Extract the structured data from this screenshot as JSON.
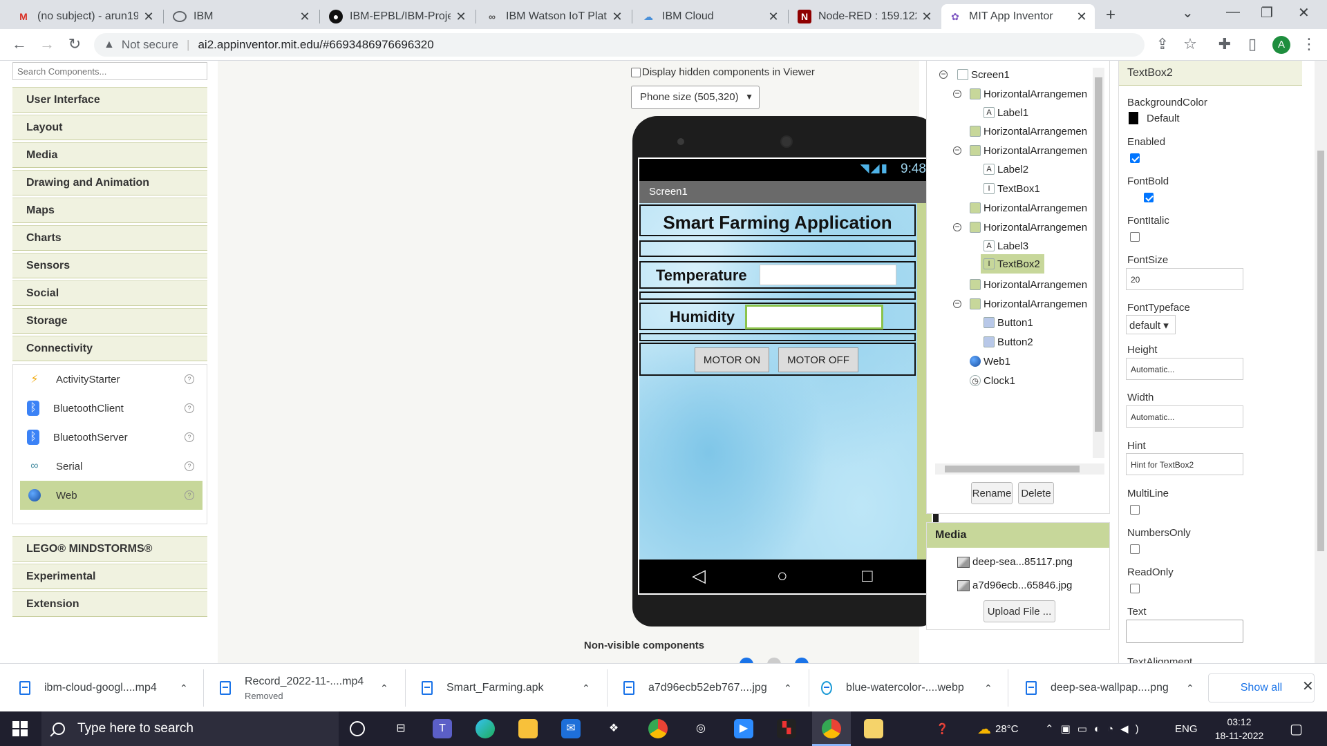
{
  "browser": {
    "tabs": [
      {
        "title": "(no subject) - arun191",
        "icon": "gmail-icon"
      },
      {
        "title": "IBM",
        "icon": "globe-icon"
      },
      {
        "title": "IBM-EPBL/IBM-Projec",
        "icon": "github-icon"
      },
      {
        "title": "IBM Watson IoT Platfo",
        "icon": "watson-icon"
      },
      {
        "title": "IBM Cloud",
        "icon": "cloud-icon"
      },
      {
        "title": "Node-RED : 159.122.1",
        "icon": "nodered-icon"
      },
      {
        "title": "MIT App Inventor",
        "icon": "appinventor-icon"
      }
    ],
    "new_tab": "+",
    "security": "Not secure",
    "url": "ai2.appinventor.mit.edu/#6693486976696320",
    "profile_initial": "A"
  },
  "palette": {
    "search_placeholder": "Search Components...",
    "categories_top": [
      "User Interface",
      "Layout",
      "Media",
      "Drawing and Animation",
      "Maps",
      "Charts",
      "Sensors",
      "Social",
      "Storage",
      "Connectivity"
    ],
    "components": [
      {
        "label": "ActivityStarter",
        "icon": "lightning-icon"
      },
      {
        "label": "BluetoothClient",
        "icon": "bluetooth-icon"
      },
      {
        "label": "BluetoothServer",
        "icon": "bluetooth-icon"
      },
      {
        "label": "Serial",
        "icon": "serial-icon"
      },
      {
        "label": "Web",
        "icon": "globe-icon"
      }
    ],
    "categories_bottom": [
      "LEGO® MINDSTORMS®",
      "Experimental",
      "Extension"
    ]
  },
  "viewer": {
    "hidden_label": "Display hidden components in Viewer",
    "phone_size": "Phone size (505,320)",
    "status_time": "9:48",
    "screen_title": "Screen1",
    "app_title": "Smart Farming Application",
    "temperature_label": "Temperature",
    "humidity_label": "Humidity",
    "motor_on": "MOTOR ON",
    "motor_off": "MOTOR OFF",
    "nonvisible_label": "Non-visible components"
  },
  "tree": {
    "nodes": [
      "Screen1",
      "HorizontalArrangemen",
      "Label1",
      "HorizontalArrangemen",
      "HorizontalArrangemen",
      "Label2",
      "TextBox1",
      "HorizontalArrangemen",
      "HorizontalArrangemen",
      "Label3",
      "TextBox2",
      "HorizontalArrangemen",
      "HorizontalArrangemen",
      "Button1",
      "Button2",
      "Web1",
      "Clock1"
    ],
    "selected": "TextBox2",
    "rename": "Rename",
    "delete": "Delete"
  },
  "media": {
    "title": "Media",
    "files": [
      "deep-sea...85117.png",
      "a7d96ecb...65846.jpg"
    ],
    "upload": "Upload File ..."
  },
  "properties": {
    "component": "TextBox2",
    "background_color_label": "BackgroundColor",
    "background_color_value": "Default",
    "enabled_label": "Enabled",
    "enabled": true,
    "fontbold_label": "FontBold",
    "fontbold": true,
    "fontitalic_label": "FontItalic",
    "fontitalic": false,
    "fontsize_label": "FontSize",
    "fontsize_value": "20",
    "fonttypeface_label": "FontTypeface",
    "fonttypeface_value": "default ▾",
    "height_label": "Height",
    "height_value": "Automatic...",
    "width_label": "Width",
    "width_value": "Automatic...",
    "hint_label": "Hint",
    "hint_value": "Hint for TextBox2",
    "multiline_label": "MultiLine",
    "numbersonly_label": "NumbersOnly",
    "readonly_label": "ReadOnly",
    "text_label": "Text",
    "textalignment_label": "TextAlignment"
  },
  "downloads": {
    "items": [
      {
        "name": "ibm-cloud-googl....mp4",
        "sub": ""
      },
      {
        "name": "Record_2022-11-....mp4",
        "sub": "Removed"
      },
      {
        "name": "Smart_Farming.apk",
        "sub": ""
      },
      {
        "name": "a7d96ecb52eb767....jpg",
        "sub": ""
      },
      {
        "name": "blue-watercolor-....webp",
        "sub": ""
      },
      {
        "name": "deep-sea-wallpap....png",
        "sub": ""
      }
    ],
    "show_all": "Show all"
  },
  "taskbar": {
    "search_placeholder": "Type here to search",
    "temperature": "28°C",
    "language": "ENG",
    "time": "03:12",
    "date": "18-11-2022"
  },
  "colors": {
    "accent_green": "#c7d79a",
    "palette_bg": "#f0f2e0",
    "link_blue": "#1a73e8"
  }
}
